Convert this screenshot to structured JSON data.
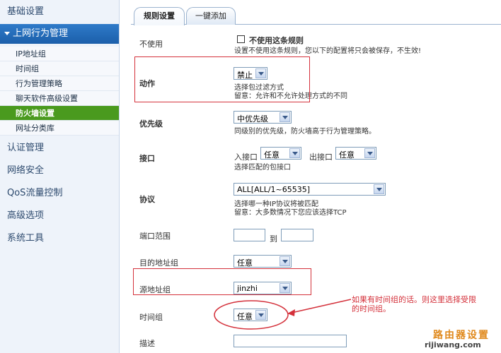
{
  "sidebar": {
    "top": "基础设置",
    "section": "上网行为管理",
    "subs": [
      "IP地址组",
      "时间组",
      "行为管理策略",
      "聊天软件高级设置",
      "防火墙设置",
      "网址分类库"
    ],
    "bottom": [
      "认证管理",
      "网络安全",
      "QoS流量控制",
      "高级选项",
      "系统工具"
    ]
  },
  "tabs": [
    "规则设置",
    "一键添加"
  ],
  "form": {
    "disable": {
      "label": "不使用",
      "checkbox_label": "不使用这条规则",
      "hint": "设置不使用这条规则，您以下的配置将只会被保存，不生效!"
    },
    "action": {
      "label": "动作",
      "value": "禁止",
      "hint1": "选择包过滤方式",
      "hint2": "留意：允许和不允许处理方式的不同"
    },
    "priority": {
      "label": "优先级",
      "value": "中优先级",
      "hint": "同级别的优先级，防火墙高于行为管理策略。"
    },
    "interface": {
      "label": "接口",
      "in_label": "入接口",
      "in_value": "任意",
      "out_label": "出接口",
      "out_value": "任意",
      "hint": "选择匹配的包接口"
    },
    "protocol": {
      "label": "协议",
      "value": "ALL[ALL/1~65535]",
      "hint1": "选择哪一种IP协议将被匹配",
      "hint2": "留意：大多数情况下您应该选择TCP"
    },
    "port": {
      "label": "端口范围",
      "to": "到"
    },
    "dst": {
      "label": "目的地址组",
      "value": "任意"
    },
    "src": {
      "label": "源地址组",
      "value": "jinzhi"
    },
    "time": {
      "label": "时间组",
      "value": "任意"
    },
    "desc": {
      "label": "描述"
    }
  },
  "annotation": {
    "line1": "如果有时间组的话。则这里选择受限",
    "line2": "的时间组。"
  },
  "watermark": {
    "line1": "路由器设置",
    "line2": "rijiwang.com"
  },
  "colors": {
    "annotation": "#d4313b",
    "active_item": "#4a9a1e",
    "section": "#1b5faa"
  }
}
